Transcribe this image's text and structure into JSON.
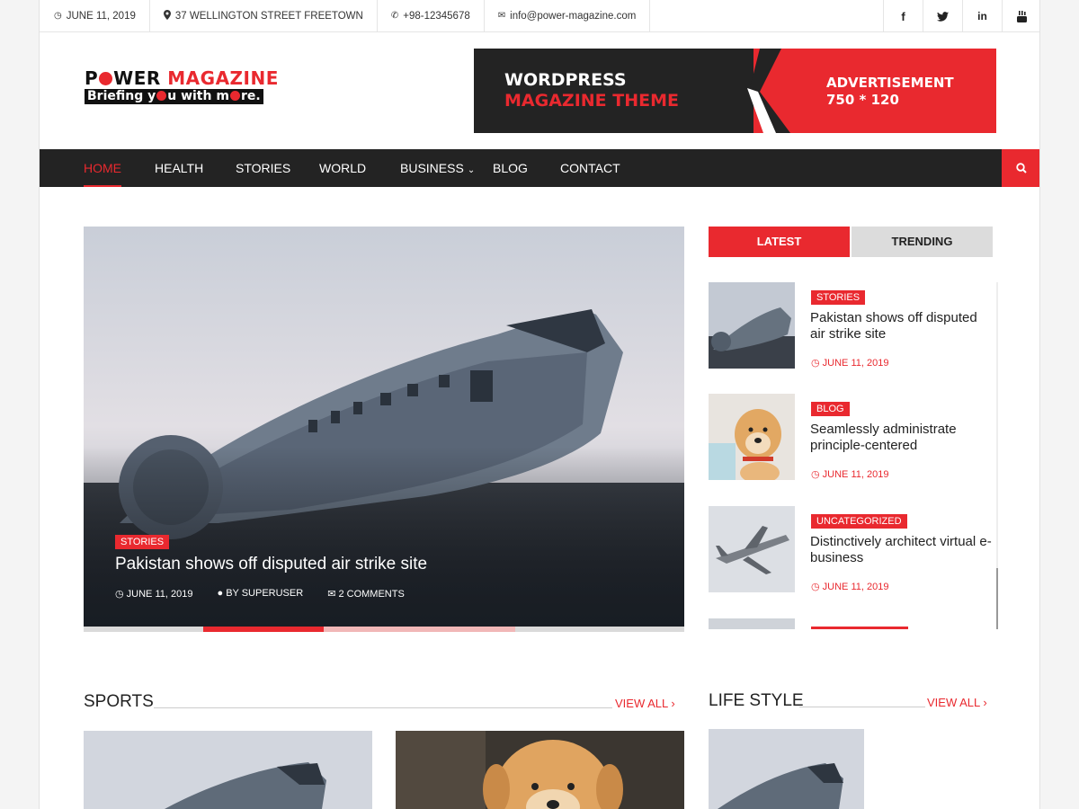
{
  "topbar": {
    "date": "JUNE 11, 2019",
    "address": "37 WELLINGTON STREET FREETOWN",
    "phone": "+98-12345678",
    "email": "info@power-magazine.com",
    "social": [
      "facebook-icon",
      "twitter-icon",
      "linkedin-icon",
      "youtube-icon"
    ]
  },
  "logo": {
    "word1": "P",
    "word1_rest": "WER",
    "word2": "MAGAZINE",
    "tagline_a": "Briefing y",
    "tagline_b": "u with m",
    "tagline_c": "re."
  },
  "ad": {
    "line1": "WORDPRESS",
    "line2": "MAGAZINE THEME",
    "line3": "ADVERTISEMENT",
    "line4": "750 * 120"
  },
  "nav": {
    "items": [
      "HOME",
      "HEALTH",
      "STORIES",
      "WORLD",
      "BUSINESS",
      "BLOG",
      "CONTACT"
    ],
    "active": "HOME",
    "dropdown": "BUSINESS"
  },
  "hero": {
    "category": "STORIES",
    "title": "Pakistan shows off disputed air strike site",
    "date": "JUNE 11, 2019",
    "author": "BY SUPERUSER",
    "comments": "2 COMMENTS"
  },
  "slider": {
    "active_index": 1,
    "segments": 5
  },
  "tabs": {
    "latest": "LATEST",
    "trending": "TRENDING",
    "active": "LATEST"
  },
  "side_posts": [
    {
      "category": "STORIES",
      "title": "Pakistan shows off disputed air strike site",
      "date": "JUNE 11, 2019"
    },
    {
      "category": "BLOG",
      "title": "Seamlessly administrate principle-centered",
      "date": "JUNE 11, 2019"
    },
    {
      "category": "UNCATEGORIZED",
      "title": "Distinctively architect virtual e-business",
      "date": "JUNE 11, 2019"
    }
  ],
  "sections": {
    "sports": {
      "title": "SPORTS",
      "view_all": "VIEW ALL"
    },
    "lifestyle": {
      "title": "LIFE STYLE",
      "view_all": "VIEW ALL"
    }
  },
  "colors": {
    "accent": "#e9292f",
    "dark": "#232323"
  }
}
